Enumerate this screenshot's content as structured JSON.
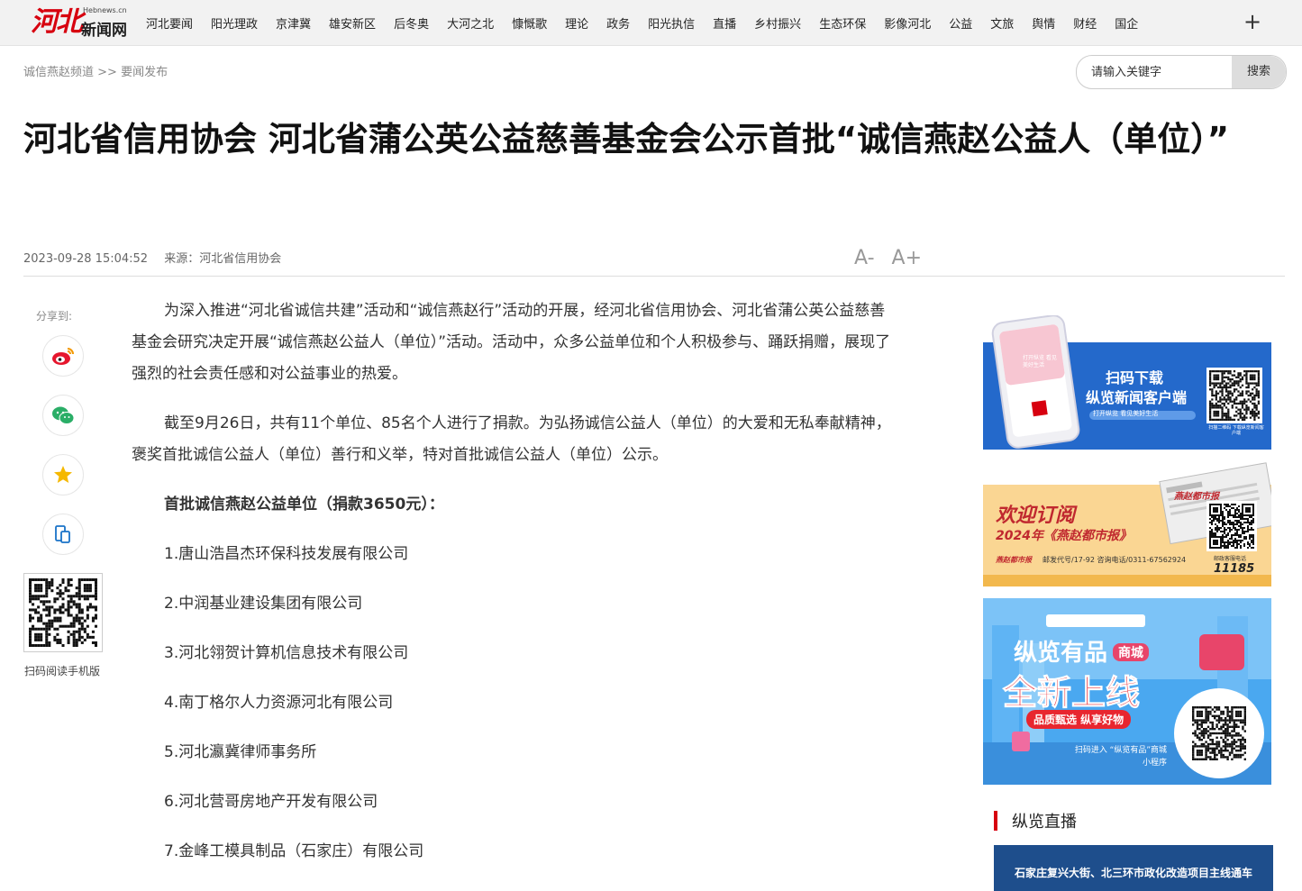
{
  "header": {
    "logo_brand": "河北",
    "logo_site": "新闻网",
    "logo_domain": "Hebnews.cn",
    "nav": [
      "河北要闻",
      "阳光理政",
      "京津冀",
      "雄安新区",
      "后冬奥",
      "大河之北",
      "慷慨歌",
      "理论",
      "政务",
      "阳光执信",
      "直播",
      "乡村振兴",
      "生态环保",
      "影像河北",
      "公益",
      "文旅",
      "舆情",
      "财经",
      "国企"
    ],
    "plus_label": "+"
  },
  "breadcrumb": {
    "channel": "诚信燕赵频道",
    "sep": ">>",
    "section": "要闻发布"
  },
  "search": {
    "placeholder": "请输入关键字",
    "button": "搜索"
  },
  "article": {
    "title": "河北省信用协会 河北省蒲公英公益慈善基金会公示首批“诚信燕赵公益人（单位）”",
    "datetime": "2023-09-28 15:04:52",
    "source": "来源：河北省信用协会",
    "font_smaller": "A-",
    "font_larger": "A+",
    "paragraphs": [
      "为深入推进“河北省诚信共建”活动和“诚信燕赵行”活动的开展，经河北省信用协会、河北省蒲公英公益慈善基金会研究决定开展“诚信燕赵公益人（单位）”活动。活动中，众多公益单位和个人积极参与、踊跃捐赠，展现了强烈的社会责任感和对公益事业的热爱。",
      "截至9月26日，共有11个单位、85名个人进行了捐款。为弘扬诚信公益人（单位）的大爱和无私奉献精神，褒奖首批诚信公益人（单位）善行和义举，特对首批诚信公益人（单位）公示。"
    ],
    "list_heading": "首批诚信燕赵公益单位（捐款3650元）：",
    "units": [
      "1.唐山浩昌杰环保科技发展有限公司",
      "2.中润基业建设集团有限公司",
      "3.河北翎贺计算机信息技术有限公司",
      "4.南丁格尔人力资源河北有限公司",
      "5.河北瀛冀律师事务所",
      "6.河北营哥房地产开发有限公司",
      "7.金峰工模具制品（石家庄）有限公司"
    ]
  },
  "share": {
    "label": "分享到:",
    "qr_label": "扫码阅读手机版"
  },
  "ads": {
    "ad1": {
      "line1": "扫码下载",
      "line2": "纵览新闻客户端",
      "line3": "打开纵览 看见美好生活",
      "qr_caption": "扫描二维码 下载纵览新闻客户端",
      "phone_text": "打开纵览 看见美好生活"
    },
    "ad2": {
      "line1": "欢迎订阅",
      "line2": "2024年《燕赵都市报》",
      "line3": "邮发代号/17-92 咨询电话/0311-67562924",
      "hotline_label": "邮政客服电话",
      "hotline": "11185",
      "paper_name": "燕赵都市报"
    },
    "ad3": {
      "brand": "纵览有品",
      "tag": "商城",
      "headline": "全新上线",
      "sub": "品质甄选 纵享好物",
      "qr_caption": "扫码进入 “纵览有品”商城小程序"
    }
  },
  "live": {
    "heading": "纵览直播",
    "caption": "石家庄复兴大街、北三环市政化改造项目主线通车"
  },
  "colors": {
    "accent": "#d7000f",
    "nav_bg": "#f2f2f2"
  }
}
